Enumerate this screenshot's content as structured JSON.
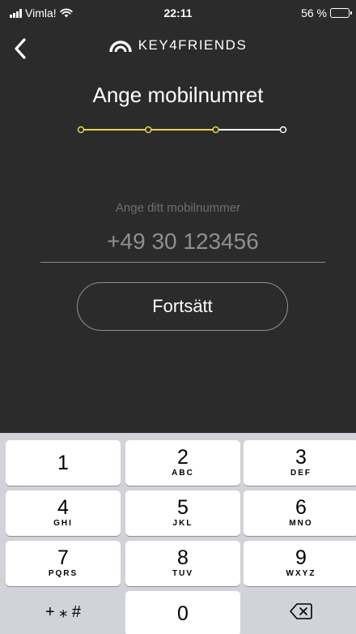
{
  "status_bar": {
    "carrier": "Vimla!",
    "time": "22:11",
    "battery_percent": "56 %",
    "battery_level": 0.56
  },
  "header": {
    "back_icon": "chevron-left-icon",
    "brand_icon": "key4friends-logo-arc",
    "brand_name": "KEY4FRIENDS"
  },
  "title": "Ange mobilnumret",
  "progress": {
    "steps_total": 4,
    "current_step": 3,
    "active_color": "#e8d44d",
    "inactive_color": "#ffffff"
  },
  "phone_field": {
    "label": "Ange ditt mobilnummer",
    "placeholder": "+49 30 123456"
  },
  "continue_label": "Fortsätt",
  "keypad": {
    "rows": [
      [
        {
          "digit": "1",
          "letters": ""
        },
        {
          "digit": "2",
          "letters": "ABC"
        },
        {
          "digit": "3",
          "letters": "DEF"
        }
      ],
      [
        {
          "digit": "4",
          "letters": "GHI"
        },
        {
          "digit": "5",
          "letters": "JKL"
        },
        {
          "digit": "6",
          "letters": "MNO"
        }
      ],
      [
        {
          "digit": "7",
          "letters": "PQRS"
        },
        {
          "digit": "8",
          "letters": "TUV"
        },
        {
          "digit": "9",
          "letters": "WXYZ"
        }
      ]
    ],
    "symbols_label": "+ ⁎ #",
    "zero": "0",
    "delete_icon": "backspace-icon"
  },
  "colors": {
    "background": "#2b2b2b",
    "accent_yellow": "#e8d44d",
    "keyboard_bg": "#d1d3d8"
  }
}
